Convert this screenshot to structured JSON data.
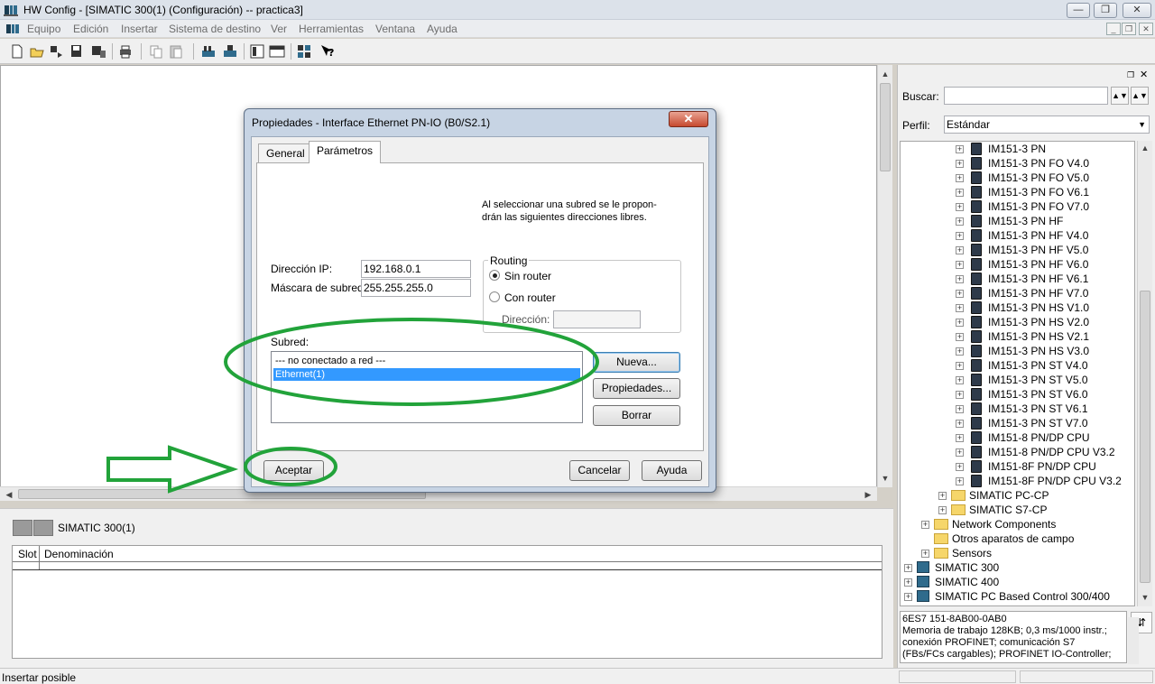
{
  "window": {
    "title": "HW Config - [SIMATIC 300(1) (Configuración) -- practica3]",
    "controls": {
      "minimize": "—",
      "maximize": "❐",
      "close": "✕"
    }
  },
  "menu": {
    "items": [
      "Equipo",
      "Edición",
      "Insertar",
      "Sistema de destino",
      "Ver",
      "Herramientas",
      "Ventana",
      "Ayuda"
    ],
    "mdi_controls": {
      "minimize": "_",
      "restore": "❐",
      "close": "✕"
    }
  },
  "toolbar": {
    "icons": [
      "new-icon",
      "open-icon",
      "save-icon",
      "save-compile-icon",
      "download-icon",
      "upload-icon",
      "print-icon",
      "copy-icon",
      "paste-icon",
      "catalog-icon",
      "network-icon",
      "properties-icon",
      "window-icon",
      "whats-this-icon"
    ]
  },
  "bottom_panel": {
    "station_name": "SIMATIC 300(1)",
    "columns": [
      "Slot",
      "Denominación"
    ]
  },
  "status": {
    "text": "Insertar posible"
  },
  "catalog": {
    "search_label": "Buscar:",
    "search_value": "",
    "profile_label": "Perfil:",
    "profile_value": "Estándar",
    "tree": [
      {
        "label": "IM151-3 PN",
        "type": "module",
        "level": 3
      },
      {
        "label": "IM151-3 PN FO V4.0",
        "type": "module",
        "level": 3
      },
      {
        "label": "IM151-3 PN FO V5.0",
        "type": "module",
        "level": 3
      },
      {
        "label": "IM151-3 PN FO V6.1",
        "type": "module",
        "level": 3
      },
      {
        "label": "IM151-3 PN FO V7.0",
        "type": "module",
        "level": 3
      },
      {
        "label": "IM151-3 PN HF",
        "type": "module",
        "level": 3
      },
      {
        "label": "IM151-3 PN HF V4.0",
        "type": "module",
        "level": 3
      },
      {
        "label": "IM151-3 PN HF V5.0",
        "type": "module",
        "level": 3
      },
      {
        "label": "IM151-3 PN HF V6.0",
        "type": "module",
        "level": 3
      },
      {
        "label": "IM151-3 PN HF V6.1",
        "type": "module",
        "level": 3
      },
      {
        "label": "IM151-3 PN HF V7.0",
        "type": "module",
        "level": 3
      },
      {
        "label": "IM151-3 PN HS V1.0",
        "type": "module",
        "level": 3
      },
      {
        "label": "IM151-3 PN HS V2.0",
        "type": "module",
        "level": 3
      },
      {
        "label": "IM151-3 PN HS V2.1",
        "type": "module",
        "level": 3
      },
      {
        "label": "IM151-3 PN HS V3.0",
        "type": "module",
        "level": 3
      },
      {
        "label": "IM151-3 PN ST V4.0",
        "type": "module",
        "level": 3
      },
      {
        "label": "IM151-3 PN ST V5.0",
        "type": "module",
        "level": 3
      },
      {
        "label": "IM151-3 PN ST V6.0",
        "type": "module",
        "level": 3
      },
      {
        "label": "IM151-3 PN ST V6.1",
        "type": "module",
        "level": 3
      },
      {
        "label": "IM151-3 PN ST V7.0",
        "type": "module",
        "level": 3
      },
      {
        "label": "IM151-8 PN/DP CPU",
        "type": "module",
        "level": 3
      },
      {
        "label": "IM151-8 PN/DP CPU V3.2",
        "type": "module",
        "level": 3
      },
      {
        "label": "IM151-8F PN/DP CPU",
        "type": "module",
        "level": 3
      },
      {
        "label": "IM151-8F PN/DP CPU V3.2",
        "type": "module",
        "level": 3
      },
      {
        "label": "SIMATIC PC-CP",
        "type": "folder",
        "level": 2
      },
      {
        "label": "SIMATIC S7-CP",
        "type": "folder",
        "level": 2
      },
      {
        "label": "Network Components",
        "type": "folder",
        "level": 1
      },
      {
        "label": "Otros aparatos de campo",
        "type": "folder-noexp",
        "level": 1
      },
      {
        "label": "Sensors",
        "type": "folder",
        "level": 1
      },
      {
        "label": "SIMATIC 300",
        "type": "station",
        "level": 0
      },
      {
        "label": "SIMATIC 400",
        "type": "station",
        "level": 0
      },
      {
        "label": "SIMATIC PC Based Control 300/400",
        "type": "station",
        "level": 0
      }
    ],
    "description": [
      "6ES7 151-8AB00-0AB0",
      "Memoria de trabajo 128KB; 0,3 ms/1000 instr.;",
      "conexión PROFINET; comunicación S7",
      "(FBs/FCs cargables); PROFINET IO-Controller;"
    ]
  },
  "dialog": {
    "title": "Propiedades - Interface Ethernet  PN-IO (B0/S2.1)",
    "close": "✕",
    "tabs": [
      "General",
      "Parámetros"
    ],
    "hint": [
      "Al seleccionar una subred se le propon-",
      "drán las siguientes direcciones libres."
    ],
    "ip_label": "Dirección IP:",
    "ip_value": "192.168.0.1",
    "mask_label": "Máscara de subred:",
    "mask_value": "255.255.255.0",
    "routing": {
      "legend": "Routing",
      "no_router": "Sin router",
      "with_router": "Con router",
      "address_label": "Dirección:",
      "address_value": ""
    },
    "subnet_label": "Subred:",
    "subnets": [
      "--- no conectado a red ---",
      "Ethernet(1)"
    ],
    "buttons": {
      "new": "Nueva...",
      "properties": "Propiedades...",
      "delete": "Borrar",
      "ok": "Aceptar",
      "cancel": "Cancelar",
      "help": "Ayuda"
    }
  },
  "annotation_color": "#22a33a"
}
